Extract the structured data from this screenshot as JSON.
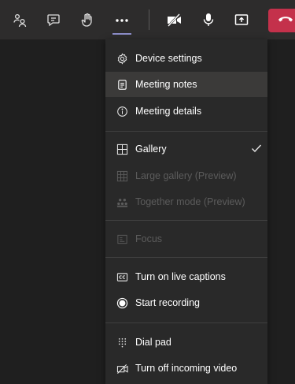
{
  "toolbar": {
    "buttons": [
      {
        "icon": "participants-icon"
      },
      {
        "icon": "chat-icon"
      },
      {
        "icon": "raise-hand-icon"
      },
      {
        "icon": "more-actions-icon"
      },
      {
        "icon": "camera-off-icon"
      },
      {
        "icon": "microphone-icon"
      },
      {
        "icon": "share-screen-icon"
      },
      {
        "icon": "hang-up-icon"
      }
    ],
    "accent_color": "#8b8cc7",
    "hangup_color": "#c4314b"
  },
  "menu": {
    "device_settings": "Device settings",
    "meeting_notes": "Meeting notes",
    "meeting_details": "Meeting details",
    "gallery": "Gallery",
    "large_gallery": "Large gallery (Preview)",
    "together_mode": "Together mode (Preview)",
    "focus": "Focus",
    "live_captions": "Turn on live captions",
    "start_recording": "Start recording",
    "dial_pad": "Dial pad",
    "incoming_video": "Turn off incoming video"
  }
}
